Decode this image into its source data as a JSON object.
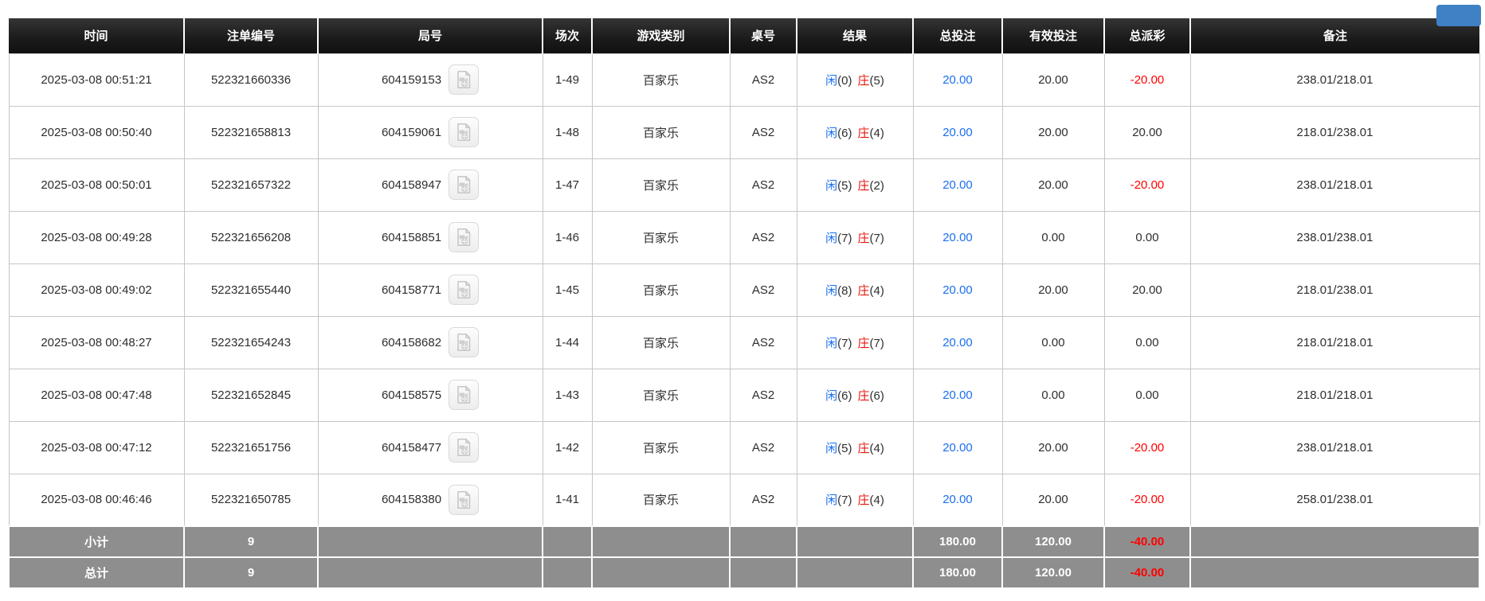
{
  "top_bar": {
    "partial_button_color": "#3f81c4"
  },
  "table": {
    "columns": [
      {
        "label": "时间"
      },
      {
        "label": "注单编号"
      },
      {
        "label": "局号"
      },
      {
        "label": "场次"
      },
      {
        "label": "游戏类别"
      },
      {
        "label": "桌号"
      },
      {
        "label": "结果"
      },
      {
        "label": "总投注"
      },
      {
        "label": "有效投注"
      },
      {
        "label": "总派彩"
      },
      {
        "label": "备注"
      }
    ],
    "rows": [
      {
        "time": "2025-03-08 00:51:21",
        "bet_no": "522321660336",
        "round_no": "604159153",
        "session": "1-49",
        "game_type": "百家乐",
        "table_no": "AS2",
        "result": {
          "p_label": "闲",
          "p_score": "(0)",
          "b_label": "庄",
          "b_score": "(5)"
        },
        "total_bet": "20.00",
        "valid_bet": "20.00",
        "total_payout": "-20.00",
        "remark": "238.01/218.01"
      },
      {
        "time": "2025-03-08 00:50:40",
        "bet_no": "522321658813",
        "round_no": "604159061",
        "session": "1-48",
        "game_type": "百家乐",
        "table_no": "AS2",
        "result": {
          "p_label": "闲",
          "p_score": "(6)",
          "b_label": "庄",
          "b_score": "(4)"
        },
        "total_bet": "20.00",
        "valid_bet": "20.00",
        "total_payout": "20.00",
        "remark": "218.01/238.01"
      },
      {
        "time": "2025-03-08 00:50:01",
        "bet_no": "522321657322",
        "round_no": "604158947",
        "session": "1-47",
        "game_type": "百家乐",
        "table_no": "AS2",
        "result": {
          "p_label": "闲",
          "p_score": "(5)",
          "b_label": "庄",
          "b_score": "(2)"
        },
        "total_bet": "20.00",
        "valid_bet": "20.00",
        "total_payout": "-20.00",
        "remark": "238.01/218.01"
      },
      {
        "time": "2025-03-08 00:49:28",
        "bet_no": "522321656208",
        "round_no": "604158851",
        "session": "1-46",
        "game_type": "百家乐",
        "table_no": "AS2",
        "result": {
          "p_label": "闲",
          "p_score": "(7)",
          "b_label": "庄",
          "b_score": "(7)"
        },
        "total_bet": "20.00",
        "valid_bet": "0.00",
        "total_payout": "0.00",
        "remark": "238.01/238.01"
      },
      {
        "time": "2025-03-08 00:49:02",
        "bet_no": "522321655440",
        "round_no": "604158771",
        "session": "1-45",
        "game_type": "百家乐",
        "table_no": "AS2",
        "result": {
          "p_label": "闲",
          "p_score": "(8)",
          "b_label": "庄",
          "b_score": "(4)"
        },
        "total_bet": "20.00",
        "valid_bet": "20.00",
        "total_payout": "20.00",
        "remark": "218.01/238.01"
      },
      {
        "time": "2025-03-08 00:48:27",
        "bet_no": "522321654243",
        "round_no": "604158682",
        "session": "1-44",
        "game_type": "百家乐",
        "table_no": "AS2",
        "result": {
          "p_label": "闲",
          "p_score": "(7)",
          "b_label": "庄",
          "b_score": "(7)"
        },
        "total_bet": "20.00",
        "valid_bet": "0.00",
        "total_payout": "0.00",
        "remark": "218.01/218.01"
      },
      {
        "time": "2025-03-08 00:47:48",
        "bet_no": "522321652845",
        "round_no": "604158575",
        "session": "1-43",
        "game_type": "百家乐",
        "table_no": "AS2",
        "result": {
          "p_label": "闲",
          "p_score": "(6)",
          "b_label": "庄",
          "b_score": "(6)"
        },
        "total_bet": "20.00",
        "valid_bet": "0.00",
        "total_payout": "0.00",
        "remark": "218.01/218.01"
      },
      {
        "time": "2025-03-08 00:47:12",
        "bet_no": "522321651756",
        "round_no": "604158477",
        "session": "1-42",
        "game_type": "百家乐",
        "table_no": "AS2",
        "result": {
          "p_label": "闲",
          "p_score": "(5)",
          "b_label": "庄",
          "b_score": "(4)"
        },
        "total_bet": "20.00",
        "valid_bet": "20.00",
        "total_payout": "-20.00",
        "remark": "238.01/218.01"
      },
      {
        "time": "2025-03-08 00:46:46",
        "bet_no": "522321650785",
        "round_no": "604158380",
        "session": "1-41",
        "game_type": "百家乐",
        "table_no": "AS2",
        "result": {
          "p_label": "闲",
          "p_score": "(7)",
          "b_label": "庄",
          "b_score": "(4)"
        },
        "total_bet": "20.00",
        "valid_bet": "20.00",
        "total_payout": "-20.00",
        "remark": "258.01/238.01"
      }
    ],
    "summary_rows": [
      {
        "label": "小计",
        "count": "9",
        "total_bet": "180.00",
        "valid_bet": "120.00",
        "total_payout": "-40.00"
      },
      {
        "label": "总计",
        "count": "9",
        "total_bet": "180.00",
        "valid_bet": "120.00",
        "total_payout": "-40.00"
      }
    ],
    "colors": {
      "accent_blue": "#1b6ff0",
      "banker_red": "#e8160c",
      "negative_red": "#ff0000",
      "header_bg": "#1c1c1c",
      "summary_bg": "#8e8e8e"
    }
  }
}
